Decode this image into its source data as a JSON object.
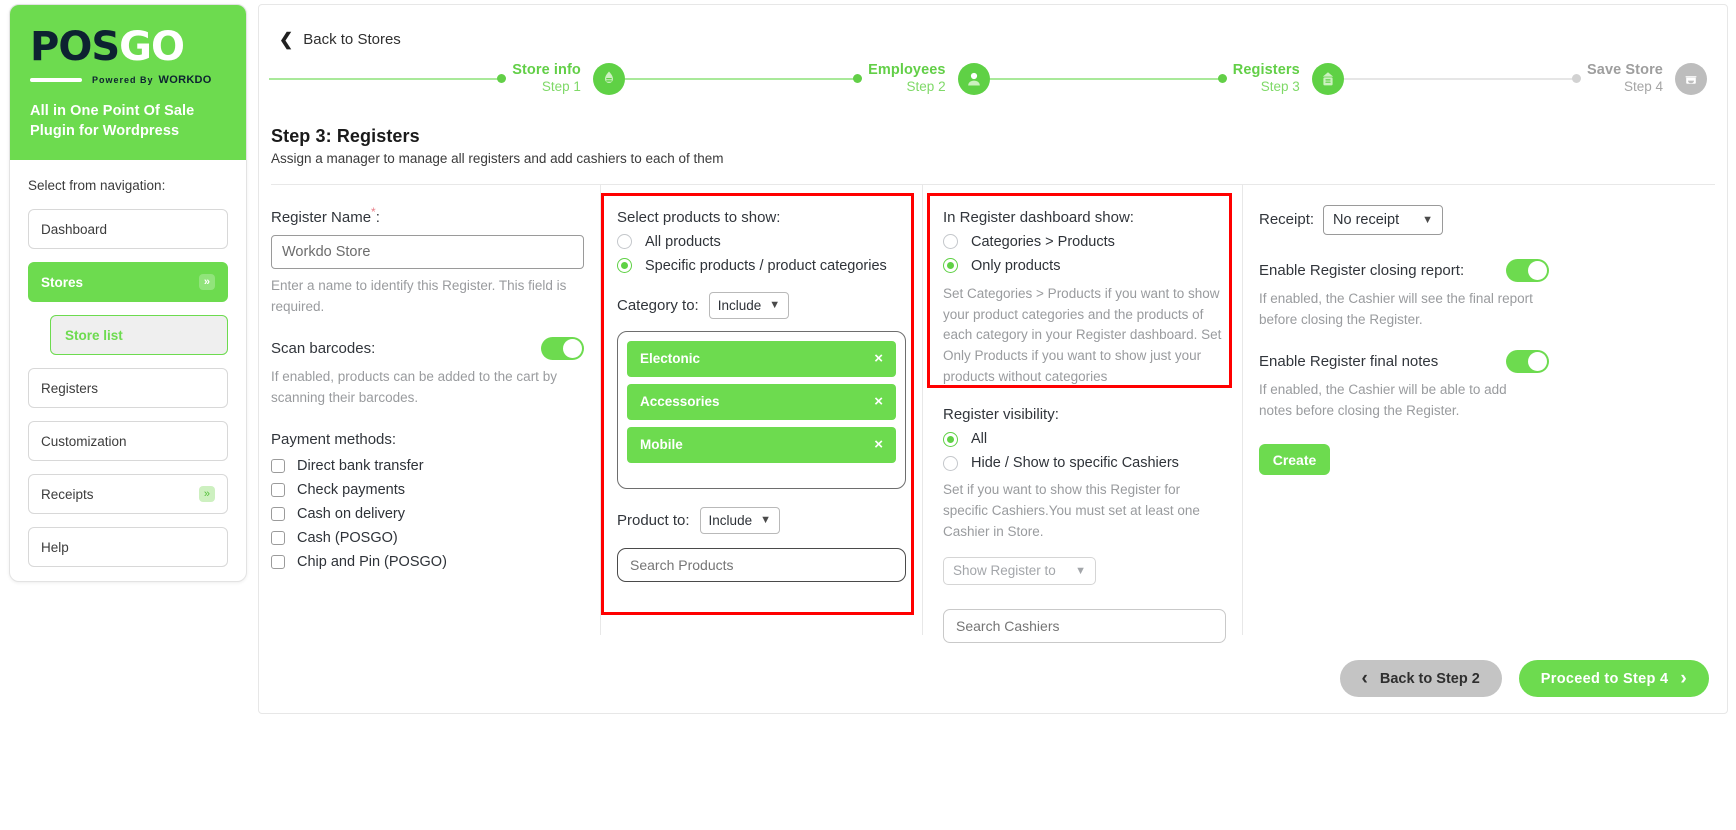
{
  "sidebar": {
    "logo": {
      "pos": "POS",
      "go": "GO",
      "powered": "Powered By",
      "workdo": "WORKDO"
    },
    "tagline": "All in One Point Of Sale Plugin for Wordpress",
    "nav_heading": "Select from navigation:",
    "items": [
      {
        "label": "Dashboard",
        "chevron": "",
        "active": false
      },
      {
        "label": "Stores",
        "chevron": "»",
        "active": true
      },
      {
        "label": "Registers",
        "chevron": "",
        "active": false
      },
      {
        "label": "Customization",
        "chevron": "",
        "active": false
      },
      {
        "label": "Receipts",
        "chevron": "»",
        "active": false
      },
      {
        "label": "Help",
        "chevron": "",
        "active": false
      }
    ],
    "sub_item": "Store list"
  },
  "header": {
    "back_label": "Back to Stores",
    "steps": [
      {
        "name": "Store info",
        "num": "Step 1",
        "icon": "store-info-icon"
      },
      {
        "name": "Employees",
        "num": "Step 2",
        "icon": "employee-icon"
      },
      {
        "name": "Registers",
        "num": "Step 3",
        "icon": "register-icon"
      },
      {
        "name": "Save Store",
        "num": "Step 4",
        "icon": "save-store-icon"
      }
    ]
  },
  "section": {
    "title": "Step 3: Registers",
    "subtitle": "Assign a manager to manage all registers and add cashiers to each of them"
  },
  "col1": {
    "register_name_label": "Register Name",
    "required_mark": "*",
    "colon": ":",
    "register_name_value": "Workdo Store",
    "register_name_hint": "Enter a name to identify this Register. This field is required.",
    "scan_barcodes_label": "Scan barcodes:",
    "scan_barcodes_hint": "If enabled, products can be added to the cart by scanning their barcodes.",
    "payment_methods_label": "Payment methods:",
    "payment_methods": [
      "Direct bank transfer",
      "Check payments",
      "Cash on delivery",
      "Cash (POSGO)",
      "Chip and Pin (POSGO)"
    ]
  },
  "col2": {
    "title": "Select products to show:",
    "options": [
      {
        "label": "All products",
        "selected": false
      },
      {
        "label": "Specific products / product categories",
        "selected": true
      }
    ],
    "category_to_label": "Category to:",
    "category_to_value": "Include",
    "tags": [
      "Electonic",
      "Accessories",
      "Mobile"
    ],
    "tag_remove": "×",
    "product_to_label": "Product to:",
    "product_to_value": "Include",
    "search_products_placeholder": "Search Products"
  },
  "col3": {
    "title": "In Register dashboard show:",
    "options": [
      {
        "label": "Categories > Products",
        "selected": false
      },
      {
        "label": "Only products",
        "selected": true
      }
    ],
    "hint": "Set Categories > Products if you want to show your product categories and the products of each category in your Register dashboard. Set Only Products if you want to show just your products without categories",
    "visibility_label": "Register visibility:",
    "visibility_options": [
      {
        "label": "All",
        "selected": true
      },
      {
        "label": "Hide / Show to specific Cashiers",
        "selected": false
      }
    ],
    "visibility_hint": "Set if you want to show this Register for specific Cashiers.You must set at least one Cashier in Store.",
    "show_register_to_value": "Show Register to",
    "search_cashiers_placeholder": "Search Cashiers"
  },
  "col4": {
    "receipt_label": "Receipt:",
    "receipt_value": "No receipt",
    "closing_report_label": "Enable Register closing report:",
    "closing_report_hint": "If enabled, the Cashier will see the final report before closing the Register.",
    "final_notes_label": "Enable Register final notes",
    "final_notes_hint": "If enabled, the Cashier will be able to add notes before closing the Register.",
    "create_label": "Create"
  },
  "footer": {
    "back_label": "Back to Step 2",
    "next_label": "Proceed to Step 4",
    "back_chevron": "‹",
    "next_chevron": "›"
  },
  "colors": {
    "brand_green": "#6ddb4f",
    "step_green": "#5fd145",
    "highlight_red": "#ff0000",
    "grey_btn": "#c4c4c4"
  }
}
